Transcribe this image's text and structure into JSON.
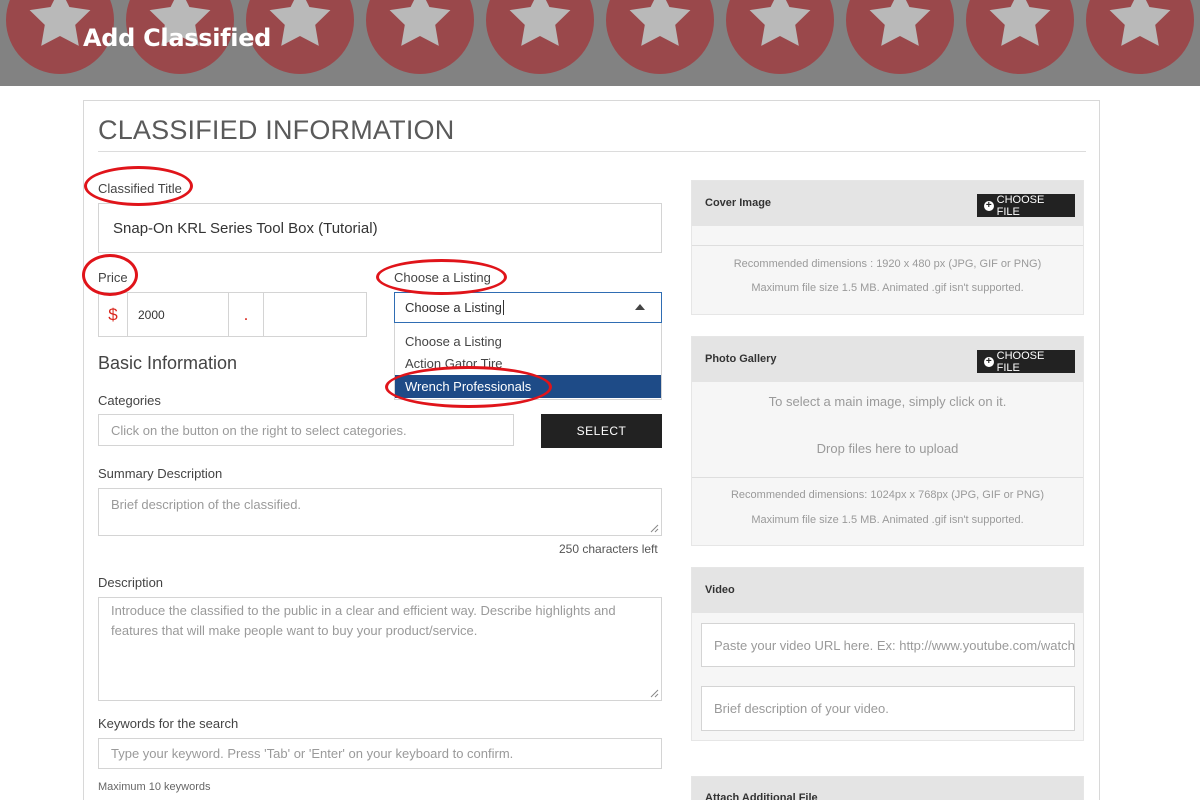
{
  "page": {
    "title": "Add Classified"
  },
  "form": {
    "section_title": "CLASSIFIED INFORMATION",
    "title_label": "Classified Title",
    "title_value": "Snap-On KRL Series Tool Box (Tutorial)",
    "price_label": "Price",
    "currency_symbol": "$",
    "price_whole": "2000",
    "price_separator": ".",
    "price_cents": "",
    "listing_label": "Choose a Listing",
    "listing_value": "Choose a Listing",
    "listing_options": [
      "Choose a Listing",
      "Action Gator Tire",
      "Wrench Professionals"
    ],
    "listing_highlighted": "Wrench Professionals",
    "basic_heading": "Basic Information",
    "categories_label": "Categories",
    "categories_placeholder": "Click on the button on the right to select categories.",
    "select_button": "SELECT",
    "summary_label": "Summary Description",
    "summary_placeholder": "Brief description of the classified.",
    "summary_counter": "250 characters left",
    "description_label": "Description",
    "description_placeholder": "Introduce the classified to the public in a clear and efficient way. Describe highlights and features that will make people want to buy your product/service.",
    "keywords_label": "Keywords for the search",
    "keywords_placeholder": "Type your keyword. Press 'Tab' or 'Enter' on your keyboard to confirm.",
    "keywords_note": "Maximum 10 keywords"
  },
  "sidebar": {
    "cover": {
      "title": "Cover Image",
      "button": "CHOOSE FILE",
      "hint_dimensions": "Recommended dimensions : 1920 x 480 px (JPG, GIF or PNG)",
      "hint_size": "Maximum file size 1.5 MB. Animated .gif isn't supported."
    },
    "gallery": {
      "title": "Photo Gallery",
      "button": "CHOOSE FILE",
      "hint_main": "To select a main image, simply click on it.",
      "hint_drop": "Drop files here to upload",
      "hint_dimensions": "Recommended dimensions: 1024px x 768px (JPG, GIF or PNG)",
      "hint_size": "Maximum file size 1.5 MB. Animated .gif isn't supported."
    },
    "video": {
      "title": "Video",
      "url_placeholder": "Paste your video URL here. Ex: http://www.youtube.com/watch",
      "desc_placeholder": "Brief description of your video."
    },
    "attach": {
      "title": "Attach Additional File"
    }
  },
  "colors": {
    "accent_red": "#d9261c",
    "highlight_ring": "#e0141a",
    "dropdown_active": "#1e4b87",
    "button_dark": "#222222",
    "banner_star_red": "#b3262b"
  },
  "icons": {
    "banner_pattern": "star-icon",
    "choose_file": "plus-circle-icon",
    "select_caret": "caret-up-icon",
    "resize": "resize-handle-icon"
  }
}
